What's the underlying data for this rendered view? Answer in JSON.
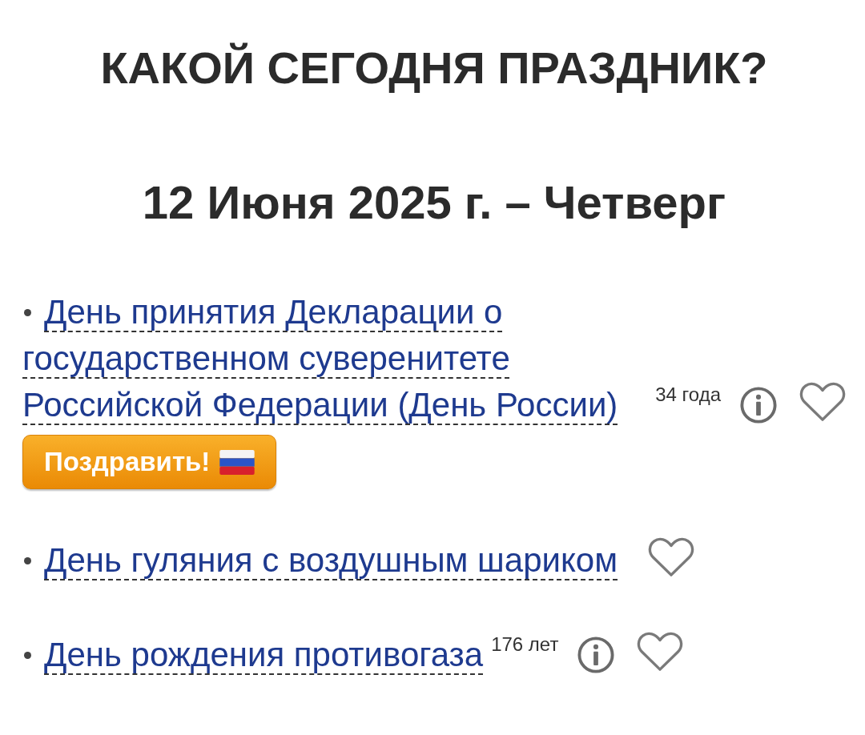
{
  "title": "КАКОЙ СЕГОДНЯ ПРАЗДНИК?",
  "date": "12 Июня 2025 г. – Четверг",
  "holidays": [
    {
      "name": "День принятия Декларации о государственном суверенитете Российской Федерации (День России)",
      "age": "34 года",
      "info": true,
      "favorite": false,
      "button": {
        "label": "Поздравить!"
      }
    },
    {
      "name": "День гуляния с воздушным шариком",
      "info": false,
      "favorite": false
    },
    {
      "name": "День рождения противогаза",
      "age": "176 лет",
      "info": true,
      "favorite": false
    }
  ]
}
